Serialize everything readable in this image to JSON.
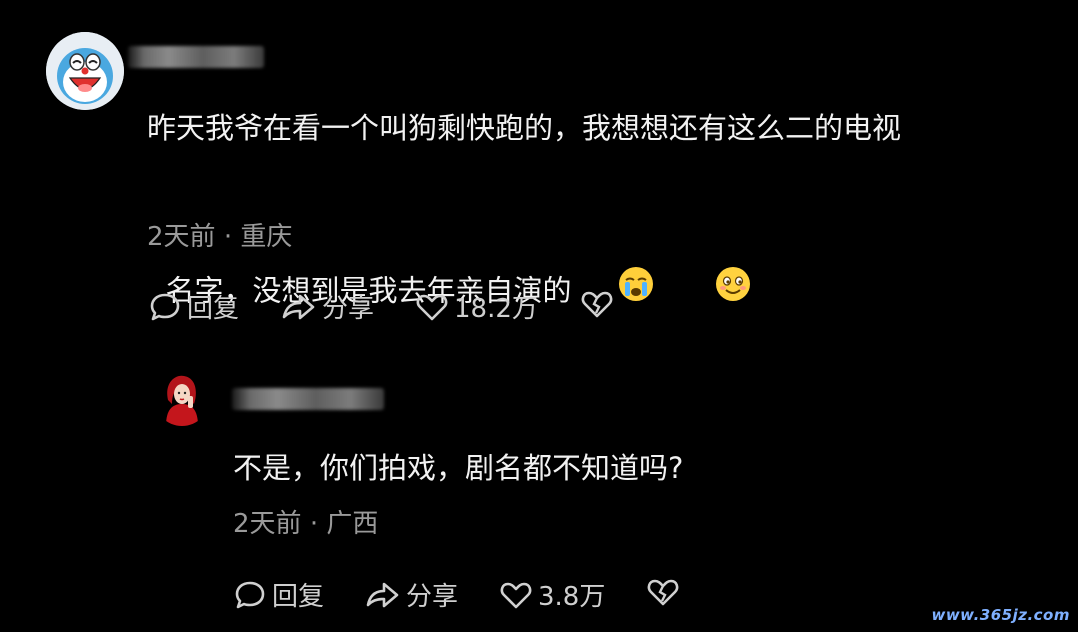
{
  "main_comment": {
    "text_line1": "昨天我爷在看一个叫狗剩快跑的，我想想还有这么二的电视",
    "text_line2": "名字，没想到是我去年亲自演的",
    "emoji_1": "loudly-crying-face",
    "emoji_2": "smiling-face",
    "time": "2天前",
    "separator": "·",
    "location": "重庆",
    "reply_label": "回复",
    "share_label": "分享",
    "like_count": "18.2万"
  },
  "reply_comment": {
    "text": "不是，你们拍戏，剧名都不知道吗?",
    "time": "2天前",
    "separator": "·",
    "location": "广西",
    "reply_label": "回复",
    "share_label": "分享",
    "like_count": "3.8万"
  },
  "watermark": "www.365jz.com",
  "colors": {
    "background": "#000000",
    "text": "#f2f2f2",
    "muted": "#9a9a9a"
  }
}
